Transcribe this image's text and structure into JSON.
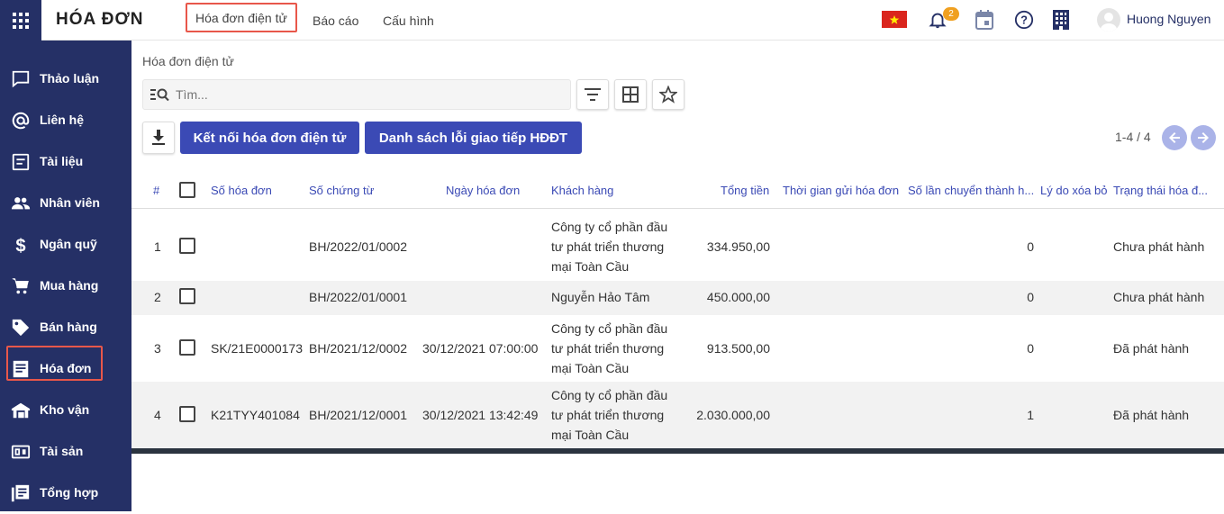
{
  "header": {
    "app_title": "HÓA ĐƠN",
    "nav": [
      "Hóa đơn điện tử",
      "Báo cáo",
      "Cấu hình"
    ],
    "notification_count": "2",
    "user_name": "Huong Nguyen"
  },
  "sidebar": {
    "items": [
      {
        "label": "Thảo luận",
        "icon": "chat-icon"
      },
      {
        "label": "Liên hệ",
        "icon": "at-icon"
      },
      {
        "label": "Tài liệu",
        "icon": "document-icon"
      },
      {
        "label": "Nhân viên",
        "icon": "people-icon"
      },
      {
        "label": "Ngân quỹ",
        "icon": "dollar-icon"
      },
      {
        "label": "Mua hàng",
        "icon": "cart-icon"
      },
      {
        "label": "Bán hàng",
        "icon": "tag-icon"
      },
      {
        "label": "Hóa đơn",
        "icon": "receipt-icon"
      },
      {
        "label": "Kho vận",
        "icon": "warehouse-icon"
      },
      {
        "label": "Tài sản",
        "icon": "asset-icon"
      },
      {
        "label": "Tổng hợp",
        "icon": "summary-icon"
      }
    ]
  },
  "content": {
    "breadcrumb": "Hóa đơn điện tử",
    "search_placeholder": "Tìm...",
    "buttons": {
      "connect": "Kết nối hóa đơn điện tử",
      "errors": "Danh sách lỗi giao tiếp HĐĐT"
    },
    "pager": "1-4 / 4"
  },
  "table": {
    "headers": {
      "num": "#",
      "invoice_no": "Số hóa đơn",
      "voucher_no": "Số chứng từ",
      "date": "Ngày hóa đơn",
      "customer": "Khách hàng",
      "total": "Tổng tiền",
      "sent_time": "Thời gian gửi hóa đơn",
      "transfer_count": "Số lần chuyển thành h...",
      "delete_reason": "Lý do xóa bỏ",
      "status": "Trạng thái hóa đ..."
    },
    "rows": [
      {
        "num": "1",
        "invoice_no": "",
        "voucher_no": "BH/2022/01/0002",
        "date": "",
        "customer": [
          "Công ty cổ phần đầu",
          "tư phát triển thương",
          "mại Toàn Cầu"
        ],
        "total": "334.950,00",
        "transfer_count": "0",
        "status": "Chưa phát hành"
      },
      {
        "num": "2",
        "invoice_no": "",
        "voucher_no": "BH/2022/01/0001",
        "date": "",
        "customer": [
          "Nguyễn Hảo Tâm"
        ],
        "total": "450.000,00",
        "transfer_count": "0",
        "status": "Chưa phát hành"
      },
      {
        "num": "3",
        "invoice_no": "SK/21E0000173",
        "voucher_no": "BH/2021/12/0002",
        "date": "30/12/2021 07:00:00",
        "customer": [
          "Công ty cổ phần đầu",
          "tư phát triển thương",
          "mại Toàn Cầu"
        ],
        "total": "913.500,00",
        "transfer_count": "0",
        "status": "Đã phát hành"
      },
      {
        "num": "4",
        "invoice_no": "K21TYY401084",
        "voucher_no": "BH/2021/12/0001",
        "date": "30/12/2021 13:42:49",
        "customer": [
          "Công ty cổ phần đầu",
          "tư phát triển thương",
          "mại Toàn Cầu"
        ],
        "total": "2.030.000,00",
        "transfer_count": "1",
        "status": "Đã phát hành"
      }
    ]
  },
  "colors": {
    "sidebar": "#253066",
    "primary": "#3b4ab5",
    "highlight": "#e8574a"
  }
}
